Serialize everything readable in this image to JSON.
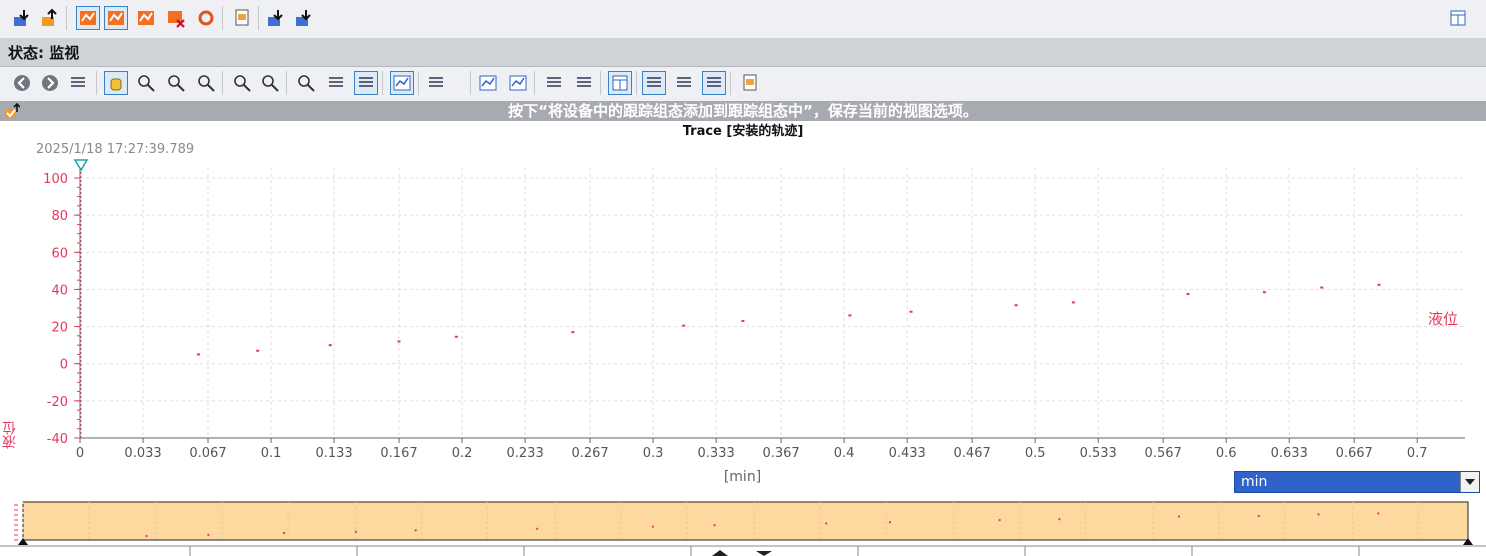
{
  "status": {
    "label": "状态: 监视"
  },
  "hint": {
    "text": "按下“将设备中的跟踪组态添加到跟踪组态中”，保存当前的视图选项。"
  },
  "chart": {
    "title": "Trace [安装的轨迹]",
    "timestamp": "2025/1/18 17:27:39.789",
    "unit_select": "min"
  },
  "toolbar_top": {
    "icons": [
      "download-icon",
      "upload-icon",
      "trace-icon",
      "trace-active-icon",
      "trace-stop-icon",
      "trace-delete-icon",
      "refresh-icon",
      "add-config-icon",
      "export-icon",
      "import-icon",
      "panel-toggle-icon"
    ]
  },
  "toolbar_2": {
    "icons": [
      "back-icon",
      "forward-icon",
      "view-icon",
      "pan-icon",
      "zoom-select-icon",
      "zoom-x-icon",
      "zoom-y-icon",
      "zoom-in-icon",
      "zoom-out-icon",
      "zoom-100-icon",
      "zoom-y-100-icon",
      "zoom-x-100-icon",
      "fit-icon",
      "timestamp-icon",
      "measure-point-icon",
      "measure-line-icon",
      "vertical-cursor-icon",
      "horizontal-cursor-icon",
      "insert-icon",
      "legend-icon",
      "align-left-icon",
      "align-right-icon",
      "save-icon"
    ]
  },
  "colors": {
    "series": "#e8365b",
    "grid": "#dedede",
    "trigger": "#1aa5a5",
    "overview_fill": "#fdd9a0",
    "accent": "#2f63c9"
  },
  "chart_data": {
    "type": "scatter",
    "title": "Trace [安装的轨迹]",
    "xlabel": "[min]",
    "ylabel": "液位",
    "xlim": [
      0,
      0.725
    ],
    "ylim": [
      -40,
      100
    ],
    "x_ticks": [
      "0",
      "0.033",
      "0.067",
      "0.1",
      "0.133",
      "0.167",
      "0.2",
      "0.233",
      "0.267",
      "0.3",
      "0.333",
      "0.367",
      "0.4",
      "0.433",
      "0.467",
      "0.5",
      "0.533",
      "0.567",
      "0.6",
      "0.633",
      "0.667",
      "0.7"
    ],
    "y_ticks": [
      "100",
      "80",
      "60",
      "40",
      "20",
      "0",
      "-20",
      "-40"
    ],
    "grid": true,
    "series": [
      {
        "name": "液位",
        "x": [
          0.062,
          0.093,
          0.131,
          0.167,
          0.197,
          0.258,
          0.316,
          0.347,
          0.403,
          0.435,
          0.49,
          0.52,
          0.58,
          0.62,
          0.65,
          0.68
        ],
        "y": [
          5,
          7,
          10,
          12,
          14.5,
          17,
          20.5,
          23,
          26,
          28,
          31.5,
          33,
          37.5,
          38.5,
          41,
          42.5
        ]
      }
    ]
  }
}
